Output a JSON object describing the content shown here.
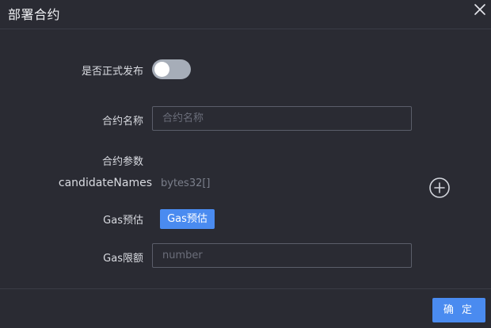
{
  "dialog": {
    "title": "部署合约"
  },
  "form": {
    "publish": {
      "label": "是否正式发布",
      "enabled": false
    },
    "contract_name": {
      "label": "合约名称",
      "value": "",
      "placeholder": "合约名称"
    },
    "contract_params": {
      "label": "合约参数",
      "params": [
        {
          "name": "candidateNames",
          "type": "bytes32[]"
        }
      ]
    },
    "gas_estimate": {
      "label": "Gas预估",
      "button_label": "Gas预估"
    },
    "gas_limit": {
      "label": "Gas限额",
      "value": "",
      "placeholder": "number"
    }
  },
  "footer": {
    "confirm_label": "确 定"
  },
  "icons": {
    "close": "close-icon",
    "add": "plus-circle-icon"
  },
  "colors": {
    "background": "#2a2b33",
    "primary": "#4a8bf0",
    "toggle_off": "#a6adb8"
  }
}
